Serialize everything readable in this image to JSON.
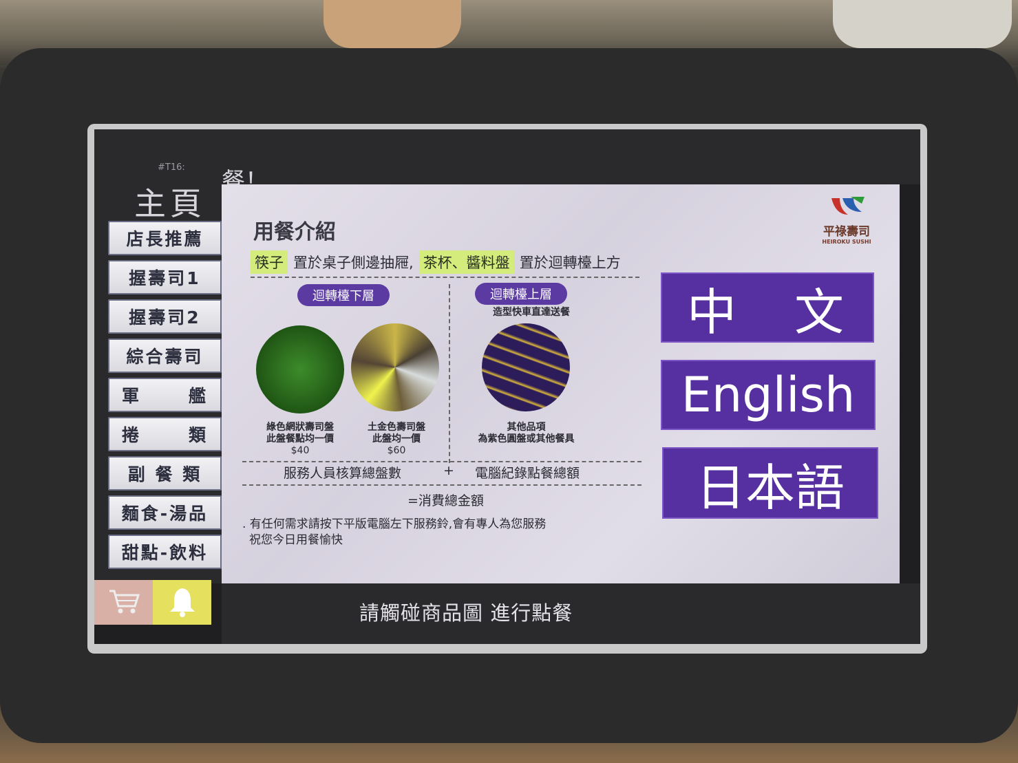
{
  "sidebar": {
    "table_no": "#T16:",
    "home_title": "主頁",
    "items": [
      {
        "label": "店長推薦"
      },
      {
        "label": "握壽司1"
      },
      {
        "label": "握壽司2"
      },
      {
        "label": "綜合壽司"
      },
      {
        "label_a": "軍",
        "label_b": "艦"
      },
      {
        "label_a": "捲",
        "label_b": "類"
      },
      {
        "label": "副 餐 類"
      },
      {
        "label": "麵食-湯品"
      },
      {
        "label": "甜點-飲料"
      }
    ]
  },
  "header": {
    "text": "餐！"
  },
  "intro": {
    "title": "用餐介紹",
    "chopsticks": "筷子",
    "chopsticks_place": "置於桌子側邊抽屜,",
    "cups": "茶杯、醬料盤",
    "cups_place": "置於迴轉檯上方",
    "lower_label": "迴轉檯下層",
    "upper_label": "迴轉檯上層",
    "upper_sub": "造型快車直達送餐",
    "plate_green_l1": "綠色網狀壽司盤",
    "plate_green_l2": "此盤餐點均一價",
    "plate_green_price": "$40",
    "plate_gold_l1": "土金色壽司盤",
    "plate_gold_l2": "此盤均一價",
    "plate_gold_price": "$60",
    "plate_purple_l1": "其他品項",
    "plate_purple_l2": "為紫色圓盤或其他餐具",
    "sum_left": "服務人員核算總盤數",
    "sum_plus": "+",
    "sum_right": "電腦紀錄點餐總額",
    "total": "=消費總金額",
    "note_l1": ". 有任何需求請按下平版電腦左下服務鈴,會有專人為您服務",
    "note_l2": "祝您今日用餐愉快"
  },
  "logo": {
    "name": "平祿壽司",
    "sub": "HEIROKU SUSHI"
  },
  "languages": {
    "zh": "中　文",
    "en": "English",
    "ja": "日本語"
  },
  "bottom": {
    "instruction": "請觸碰商品圖 進行點餐"
  },
  "icons": {
    "cart": "cart-icon",
    "bell": "bell-icon"
  },
  "colors": {
    "accent": "#5630a0",
    "highlight": "#d3ec7c",
    "bell_bg": "#e5e05d",
    "cart_bg": "#d9b0a6"
  }
}
